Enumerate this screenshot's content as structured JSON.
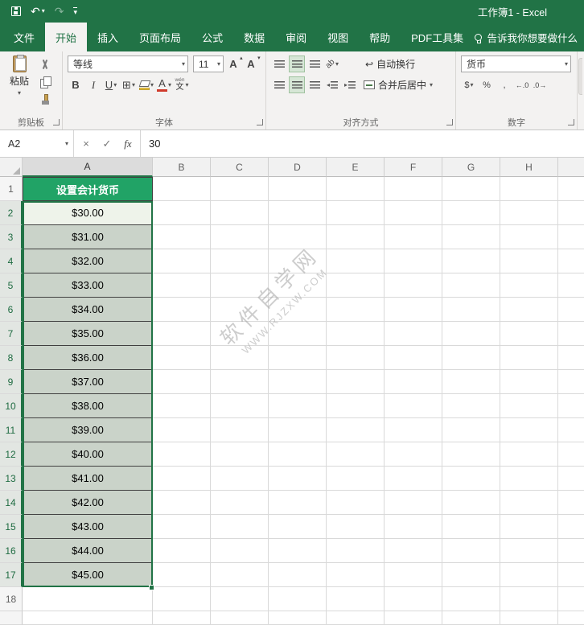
{
  "title_bar": {
    "title": "工作簿1 - Excel"
  },
  "tabs": {
    "items": [
      "文件",
      "开始",
      "插入",
      "页面布局",
      "公式",
      "数据",
      "审阅",
      "视图",
      "帮助",
      "PDF工具集"
    ],
    "active": "开始",
    "tell_me": "告诉我你想要做什么"
  },
  "ribbon": {
    "clipboard": {
      "label": "剪贴板",
      "paste": "粘贴"
    },
    "font": {
      "label": "字体",
      "name": "等线",
      "size": "11"
    },
    "alignment": {
      "label": "对齐方式",
      "wrap_text": "自动换行",
      "merge_center": "合并后居中"
    },
    "number": {
      "label": "数字",
      "format": "货币"
    }
  },
  "formula_bar": {
    "name_box": "A2",
    "value": "30"
  },
  "sheet": {
    "col_headers": [
      "A",
      "B",
      "C",
      "D",
      "E",
      "F",
      "G",
      "H"
    ],
    "row_headers": [
      "1",
      "2",
      "3",
      "4",
      "5",
      "6",
      "7",
      "8",
      "9",
      "10",
      "11",
      "12",
      "13",
      "14",
      "15",
      "16",
      "17",
      "18"
    ],
    "a1": "设置会计货币",
    "values": [
      "$30.00",
      "$31.00",
      "$32.00",
      "$33.00",
      "$34.00",
      "$35.00",
      "$36.00",
      "$37.00",
      "$38.00",
      "$39.00",
      "$40.00",
      "$41.00",
      "$42.00",
      "$43.00",
      "$44.00",
      "$45.00"
    ],
    "selection": {
      "active_cell": "A2",
      "range": "A2:A17"
    }
  },
  "watermark": {
    "line1": "软件自学网",
    "line2": "WWW.RJZXW.COM"
  },
  "colors": {
    "accent": "#217346",
    "a1_fill": "#21a366",
    "selected_fill": "#cad3c9",
    "active_cell_fill": "#eef3ea"
  },
  "icons": {
    "dropdown": "▾",
    "caret_up": "▴",
    "caret_down": "▾",
    "undo": "↶",
    "redo": "↷",
    "bold": "B",
    "italic": "I",
    "underline": "U",
    "borders": "⊞",
    "font_color_letter": "A",
    "grow_font": "A",
    "shrink_font": "A",
    "phonetic_top": "wén",
    "phonetic_bottom": "文",
    "orientation": "ab",
    "wrap_arrow": "↩",
    "currency": "$",
    "percent": "%",
    "comma": ",",
    "increase_decimal": "←.0",
    "decrease_decimal": ".0→",
    "cancel": "×",
    "enter": "✓",
    "fx": "fx"
  }
}
